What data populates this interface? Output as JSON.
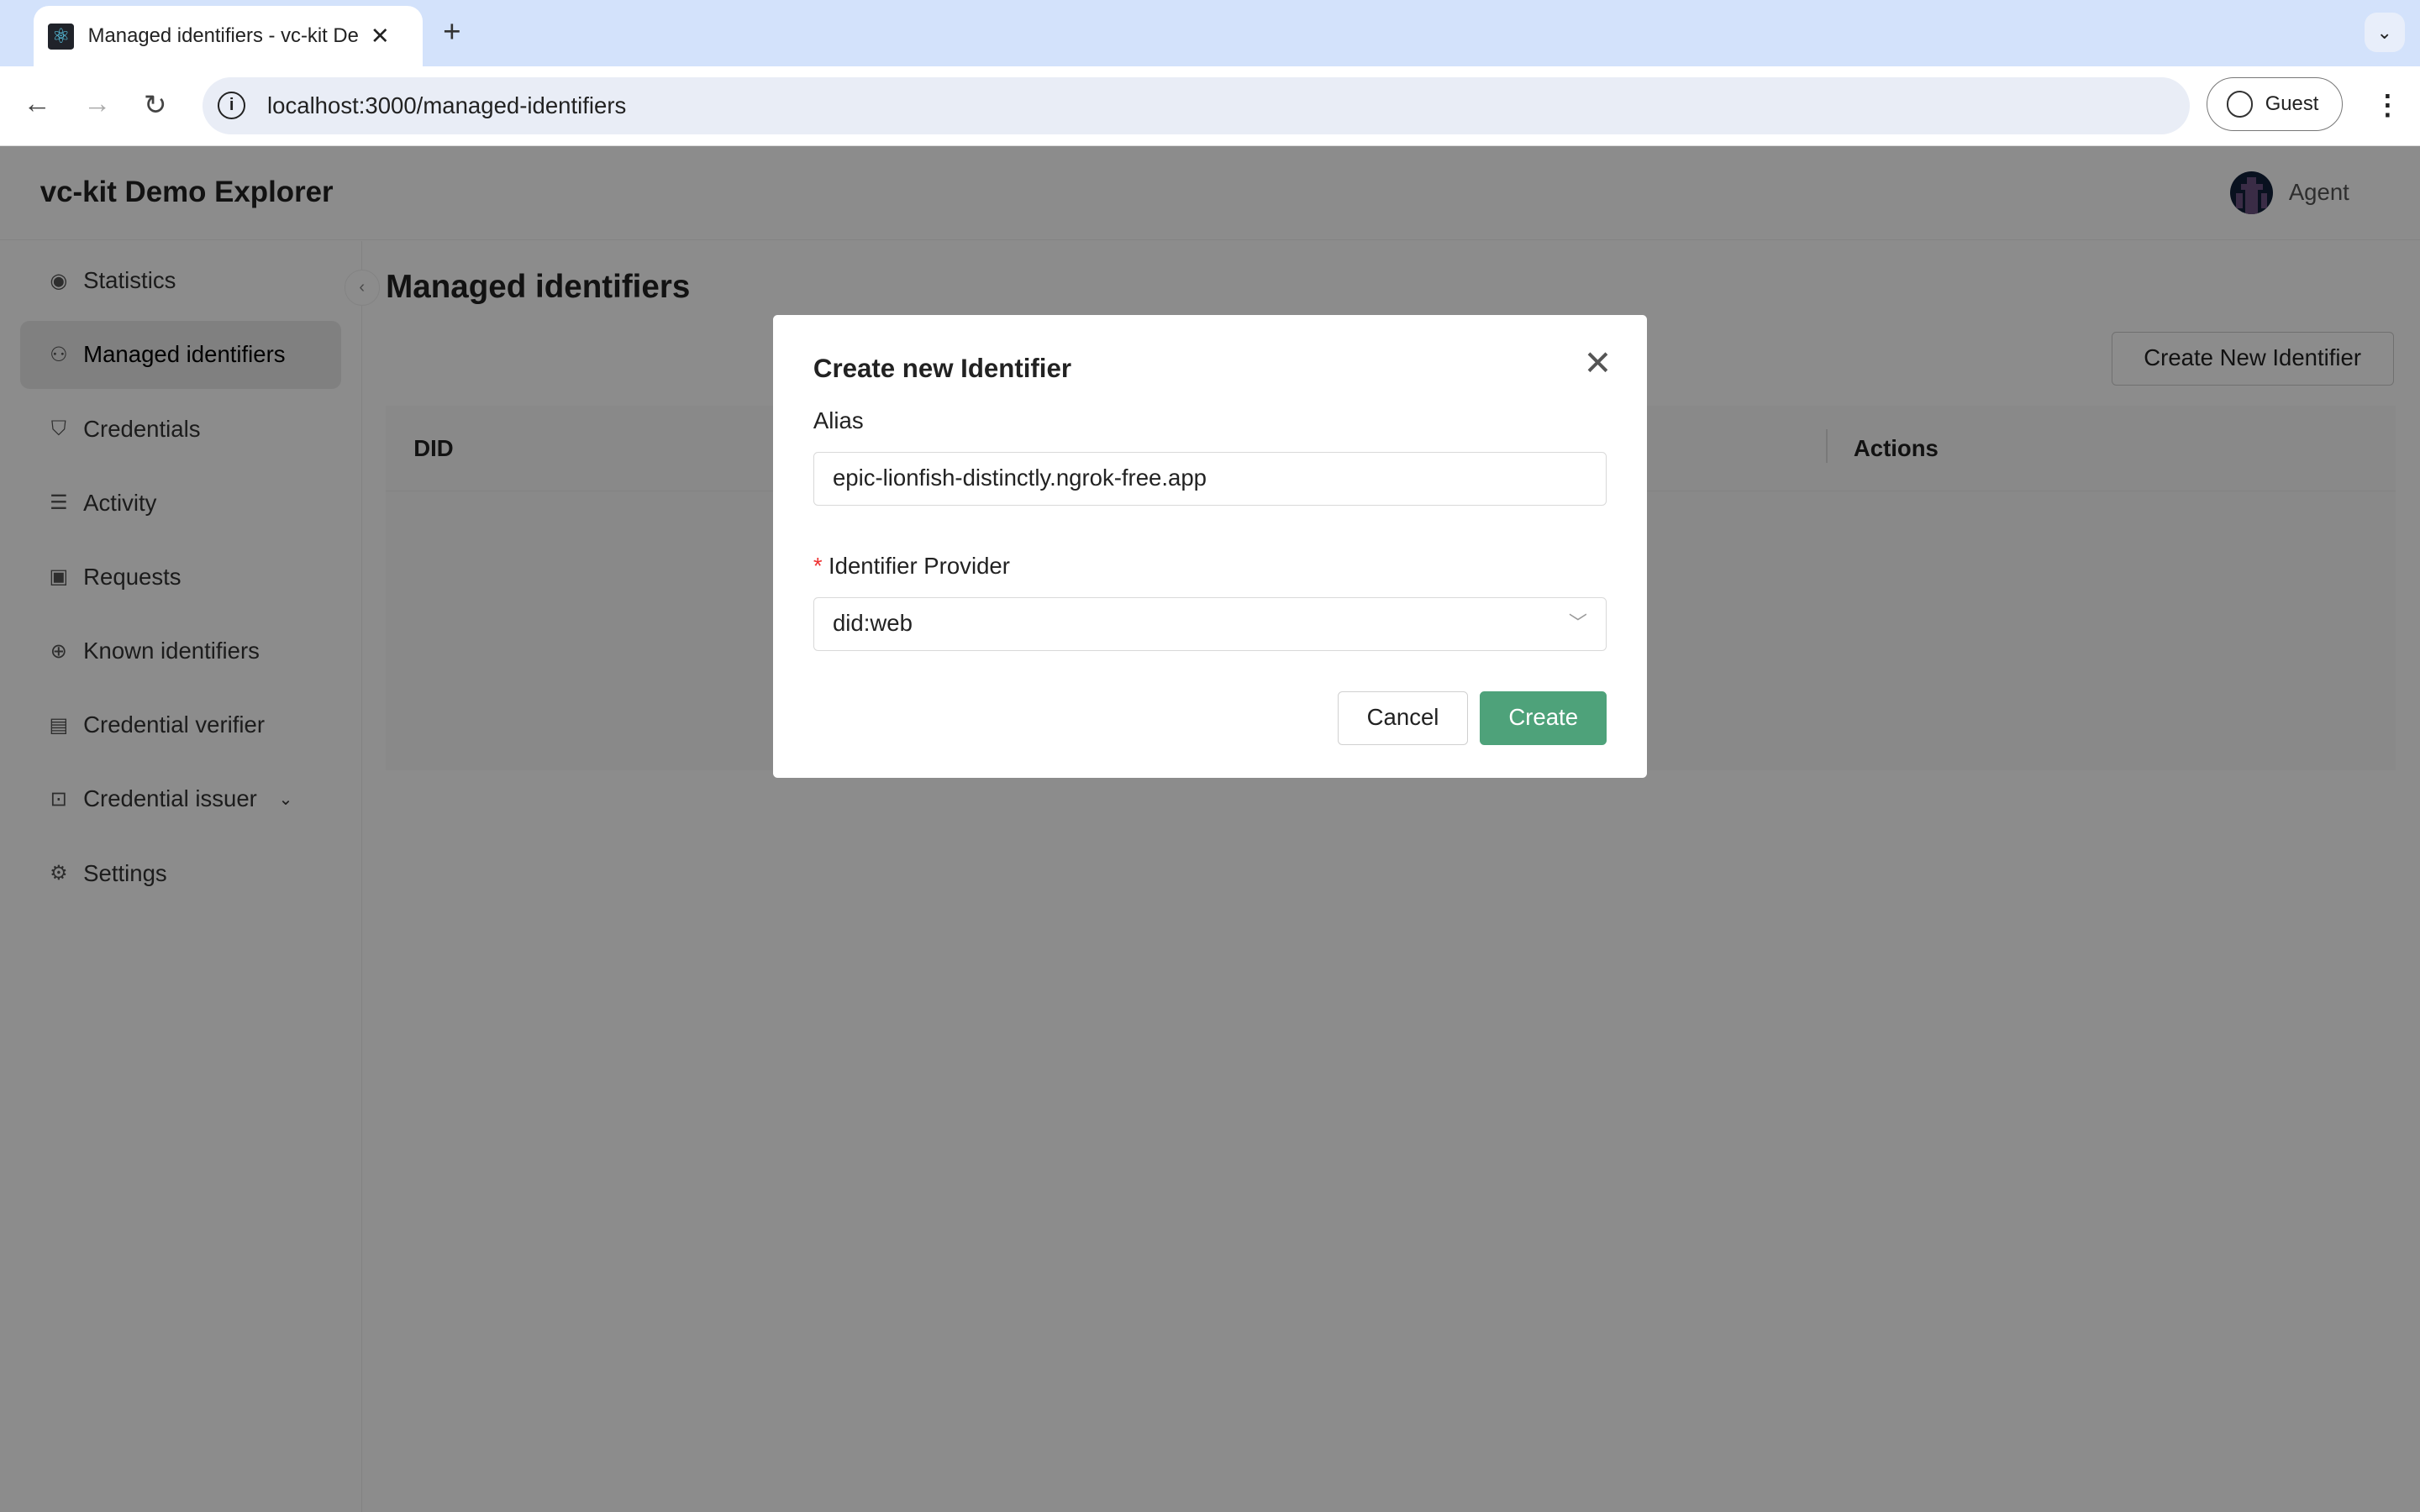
{
  "browser": {
    "tab_title": "Managed identifiers - vc-kit Demo Explorer",
    "url": "localhost:3000/managed-identifiers",
    "profile": "Guest"
  },
  "header": {
    "brand": "vc-kit Demo Explorer",
    "user": "Agent"
  },
  "sidebar": {
    "items": [
      {
        "label": "Statistics",
        "icon": "eye-icon",
        "glyph": "◉"
      },
      {
        "label": "Managed identifiers",
        "icon": "user-icon",
        "glyph": "⚇"
      },
      {
        "label": "Credentials",
        "icon": "shield-icon",
        "glyph": "⛉"
      },
      {
        "label": "Activity",
        "icon": "list-icon",
        "glyph": "☰"
      },
      {
        "label": "Requests",
        "icon": "inbox-icon",
        "glyph": "▣"
      },
      {
        "label": "Known identifiers",
        "icon": "globe-icon",
        "glyph": "⊕"
      },
      {
        "label": "Credential verifier",
        "icon": "file-check-icon",
        "glyph": "▤"
      },
      {
        "label": "Credential issuer",
        "icon": "terminal-icon",
        "glyph": "⊡"
      },
      {
        "label": "Settings",
        "icon": "gear-icon",
        "glyph": "⚙"
      }
    ],
    "active": "Managed identifiers"
  },
  "main": {
    "title": "Managed identifiers",
    "create_button": "Create New Identifier",
    "columns": [
      "DID",
      "Actions"
    ]
  },
  "modal": {
    "title": "Create new Identifier",
    "alias_label": "Alias",
    "alias_value": "epic-lionfish-distinctly.ngrok-free.app",
    "provider_label": "Identifier Provider",
    "provider_value": "did:web",
    "cancel": "Cancel",
    "create": "Create"
  },
  "colors": {
    "primary": "#4ea27a",
    "tabbar": "#d3e2fb"
  }
}
